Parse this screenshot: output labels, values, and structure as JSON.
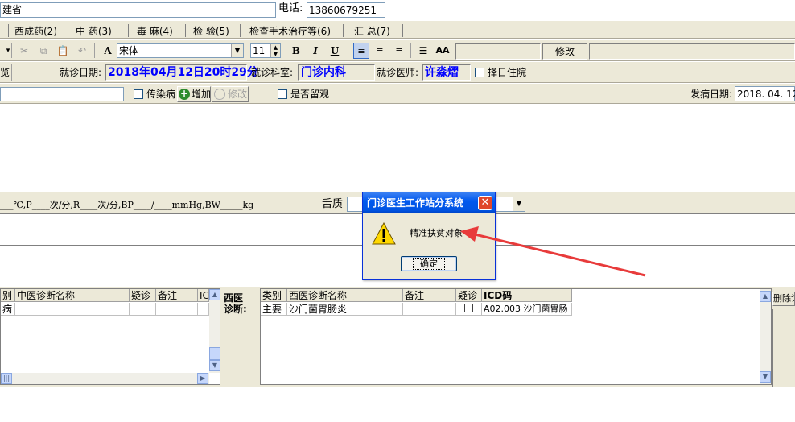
{
  "patient": {
    "province_label": "建省",
    "phone_label": "电话:",
    "phone_value": "13860679251"
  },
  "tabs": [
    {
      "label": "西成药(2)"
    },
    {
      "label": "中 药(3)"
    },
    {
      "label": "毒 麻(4)"
    },
    {
      "label": "检 验(5)"
    },
    {
      "label": "检查手术治疗等(6)"
    },
    {
      "label": "汇 总(7)"
    }
  ],
  "toolbar": {
    "font_name": "宋体",
    "font_size": "11",
    "bold": "B",
    "italic": "I",
    "underline": "U",
    "font_scale": "AA",
    "modify_label": "修改"
  },
  "visit": {
    "row_start": "览",
    "date_label": "就诊日期:",
    "date_value": "2018年04月12日20时29分",
    "dept_label": "就诊科室:",
    "dept_value": "门诊内科",
    "doctor_label": "就诊医师:",
    "doctor_value": "许淼熠",
    "admit_label": "择日住院"
  },
  "row3": {
    "infectious_label": "传染病",
    "add_label": "增加",
    "edit_label": "修改",
    "observe_label": "是否留观",
    "onset_label": "发病日期:",
    "onset_value": "2018. 04. 12"
  },
  "vitals": {
    "text": "___℃,P____次/分,R____次/分,BP____/____mmHg,BW_____kg",
    "tongue_label": "舌质"
  },
  "dialog": {
    "title": "门诊医生工作站分系统",
    "message": "精准扶贫对象",
    "ok_label": "确定"
  },
  "tcm_table": {
    "headers": [
      "别",
      "中医诊断名称",
      "疑诊",
      "备注",
      "ICI"
    ],
    "rows": [
      [
        "病",
        "",
        "",
        "",
        ""
      ]
    ]
  },
  "western": {
    "section_label_1": "西医",
    "section_label_2": "诊断:",
    "headers": [
      "类别",
      "西医诊断名称",
      "备注",
      "疑诊",
      "ICD码"
    ],
    "rows": [
      [
        "主要",
        "沙门菌胃肠炎",
        "",
        "",
        "A02.003 沙门菌胃肠"
      ]
    ],
    "delete_label": "删除诊"
  }
}
